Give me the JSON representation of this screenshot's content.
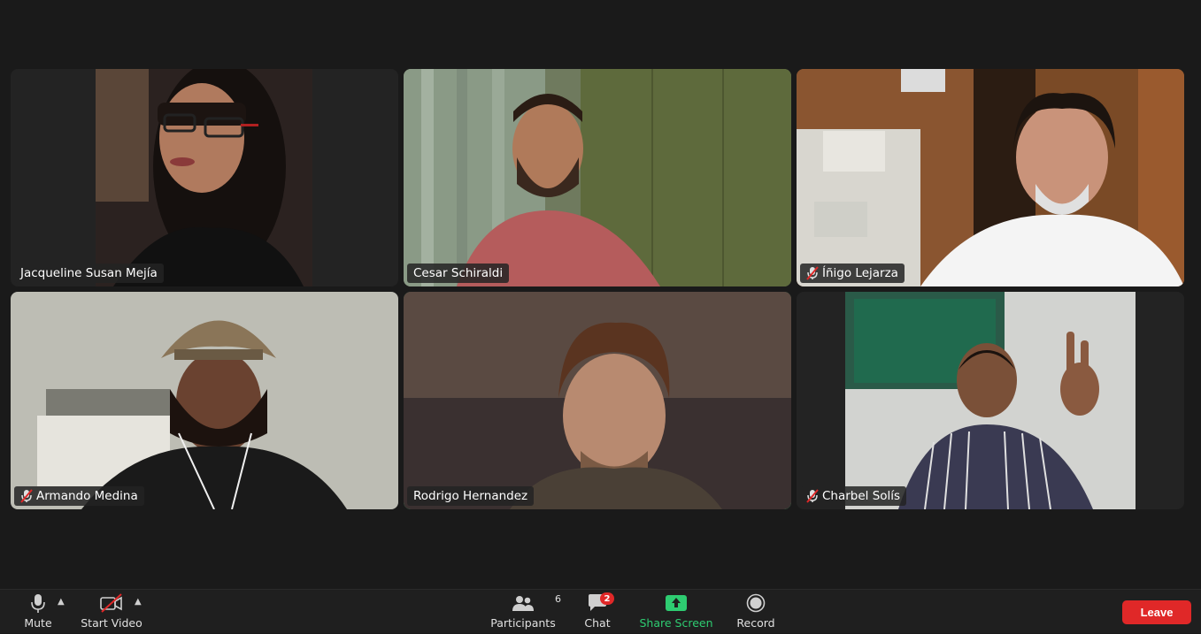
{
  "participants": [
    {
      "name": "Jacqueline Susan Mejía",
      "muted": false,
      "speaking": false
    },
    {
      "name": "Cesar Schiraldi",
      "muted": false,
      "speaking": false
    },
    {
      "name": "Íñigo Lejarza",
      "muted": true,
      "speaking": false
    },
    {
      "name": "Armando Medina",
      "muted": true,
      "speaking": false
    },
    {
      "name": "Rodrigo Hernandez",
      "muted": false,
      "speaking": true
    },
    {
      "name": "Charbel Solís",
      "muted": true,
      "speaking": false
    }
  ],
  "toolbar": {
    "mute_label": "Mute",
    "start_video_label": "Start Video",
    "participants_label": "Participants",
    "participants_count": "6",
    "chat_label": "Chat",
    "chat_badge": "2",
    "share_screen_label": "Share Screen",
    "record_label": "Record",
    "leave_label": "Leave"
  },
  "colors": {
    "background": "#1a1a1a",
    "active_speaker_border": "#2ecc71",
    "share_screen": "#2ecc71",
    "leave_button": "#e02828",
    "badge": "#e02828"
  }
}
